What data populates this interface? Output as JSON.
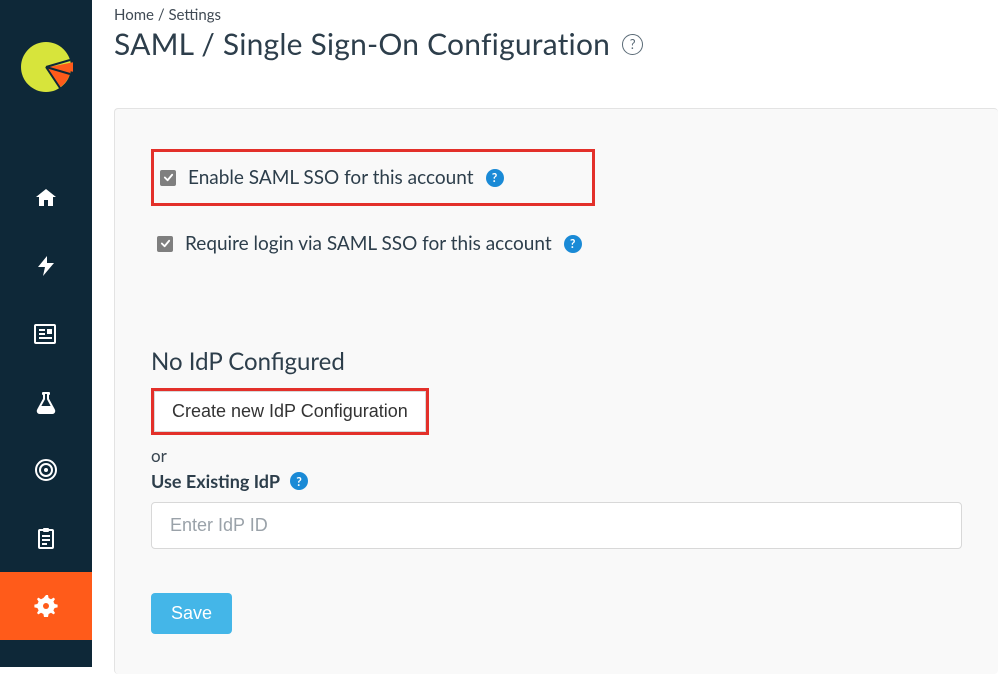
{
  "breadcrumb": {
    "home": "Home",
    "settings": "Settings",
    "sep": " / "
  },
  "page": {
    "title": "SAML / Single Sign-On Configuration"
  },
  "panel": {
    "enable_label": "Enable SAML SSO for this account",
    "require_label": "Require login via SAML SSO for this account",
    "no_idp_heading": "No IdP Configured",
    "create_idp_button": "Create new IdP Configuration",
    "or_text": "or",
    "use_existing_label": "Use Existing IdP",
    "idp_placeholder": "Enter IdP ID",
    "idp_value": "",
    "save_label": "Save"
  },
  "sidebar": {
    "items": [
      {
        "name": "home"
      },
      {
        "name": "lightning"
      },
      {
        "name": "news"
      },
      {
        "name": "flask"
      },
      {
        "name": "target"
      },
      {
        "name": "clipboard"
      },
      {
        "name": "settings"
      }
    ]
  },
  "colors": {
    "sidebar_bg": "#0e2838",
    "accent_orange": "#ff5b1a",
    "highlight_red": "#e3302a",
    "help_blue": "#1a8ad6",
    "save_blue": "#44b6e8"
  }
}
